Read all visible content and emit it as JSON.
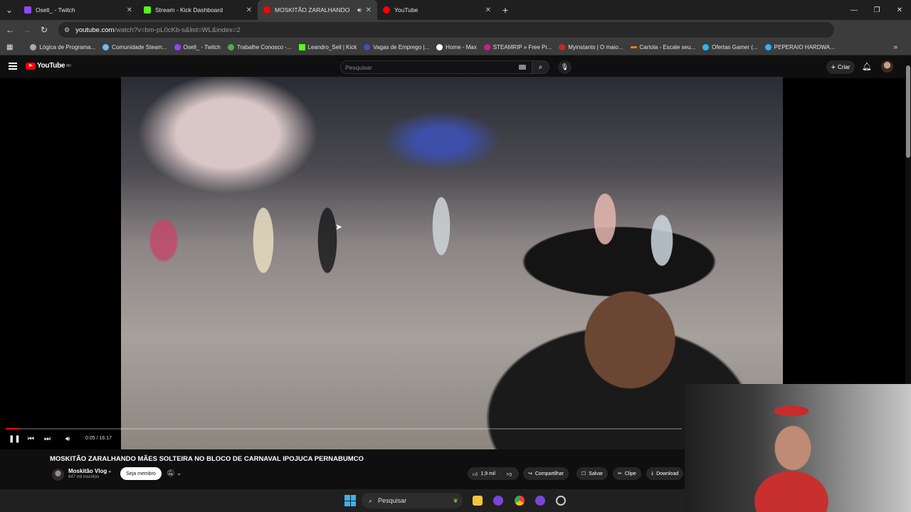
{
  "browser": {
    "tabs": [
      {
        "title": "Osell_ - Twitch",
        "favicon_color": "#9146ff"
      },
      {
        "title": "Stream - Kick Dashboard",
        "favicon_color": "#53fc18"
      },
      {
        "title": "MOSKITÃO ZARALHANDO",
        "favicon_color": "#ff0000",
        "active": true
      },
      {
        "title": "YouTube",
        "favicon_color": "#ff0000"
      }
    ],
    "url_host": "youtube.com",
    "url_path": "/watch?v=bm-pL0cKb-s&list=WL&index=2",
    "bookmarks": [
      {
        "label": "Lógica de Programa...",
        "color": "#aaaaaa"
      },
      {
        "label": "Comunidade Steam...",
        "color": "#66c0f4"
      },
      {
        "label": "Osell_ - Twitch",
        "color": "#9146ff"
      },
      {
        "label": "Trabalhe Conosco -...",
        "color": "#4caf50"
      },
      {
        "label": "Leandro_Sell | Kick",
        "color": "#53fc18"
      },
      {
        "label": "Vagas de Emprego |...",
        "color": "#3f51b5"
      },
      {
        "label": "Home - Max",
        "color": "#ffffff"
      },
      {
        "label": "STEAMRIP » Free Pr...",
        "color": "#d61a8a"
      },
      {
        "label": "Myinstants | O maio...",
        "color": "#c62828"
      },
      {
        "label": "Cartola - Escale seu...",
        "color": "#f57c00"
      },
      {
        "label": "Ofertas Gamer (...",
        "color": "#29b6f6"
      },
      {
        "label": "PEPERAIO HARDWA...",
        "color": "#29b6f6"
      }
    ]
  },
  "youtube": {
    "logo_text": "YouTube",
    "logo_region": "BR",
    "search_placeholder": "Pesquisar",
    "create_label": "Criar",
    "video": {
      "current_time": "0:05",
      "duration": "16:17",
      "progress_fraction": 0.005,
      "title": "MOSKITÃO ZARALHANDO MÃES SOLTEIRA NO BLOCO DE CARNAVAL IPOJUCA PERNABUMCO"
    },
    "channel": {
      "name": "Moskitão Vlog",
      "subscribers": "647 mil inscritos",
      "member_button": "Seja membro"
    },
    "actions": {
      "likes": "1,9 mil",
      "share": "Compartilhar",
      "save": "Salvar",
      "clip": "Clipe",
      "download": "Download"
    }
  },
  "taskbar": {
    "search_label": "Pesquisar"
  }
}
